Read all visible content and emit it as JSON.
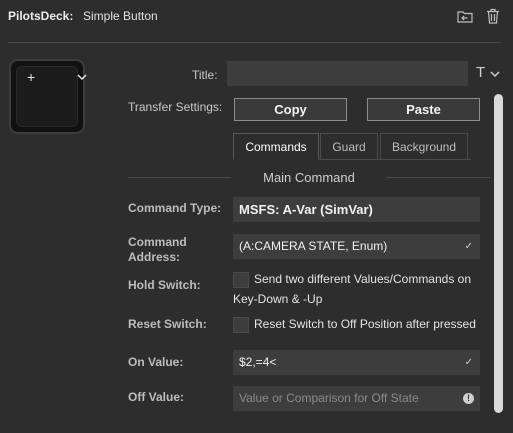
{
  "header": {
    "plugin_name": "PilotsDeck:",
    "action_name": "Simple Button"
  },
  "icons": {
    "header": [
      "back-to-folder-icon",
      "trash-icon"
    ],
    "key": [
      "plus-icon",
      "chevron-down-icon"
    ],
    "title_tools": [
      "text-format-icon",
      "chevron-down-icon"
    ],
    "fields": [
      "checkmark-icon",
      "warning-icon"
    ]
  },
  "form": {
    "title_label": "Title:",
    "title_value": "",
    "transfer_label": "Transfer Settings:",
    "copy_label": "Copy",
    "paste_label": "Paste",
    "tabs": [
      "Commands",
      "Guard",
      "Background"
    ],
    "active_tab": "Commands",
    "section_title": "Main Command",
    "command_type_label": "Command Type:",
    "command_type_value": "MSFS: A-Var (SimVar)",
    "command_address_label_1": "Command",
    "command_address_label_2": "Address:",
    "command_address_value": "(A:CAMERA STATE, Enum)",
    "hold_switch_label": "Hold Switch:",
    "hold_switch_text_1": "Send two different Values/Commands on",
    "hold_switch_text_2": "Key-Down & -Up",
    "hold_switch_checked": false,
    "reset_switch_label": "Reset Switch:",
    "reset_switch_text": "Reset Switch to Off Position after pressed",
    "reset_switch_checked": false,
    "on_value_label": "On Value:",
    "on_value": "$2,=4<",
    "off_value_label": "Off Value:",
    "off_value_placeholder": "Value or Comparison for Off State",
    "off_value": ""
  },
  "glyphs": {
    "plus": "+",
    "text_format": "T",
    "check": "✓",
    "warn": "!"
  },
  "colors": {
    "background": "#2d2d2d",
    "field_background": "#3d3d3d",
    "button_border": "#8c8c8c",
    "text": "#d6d6d6",
    "scrollbar": "#d9d9d9"
  }
}
